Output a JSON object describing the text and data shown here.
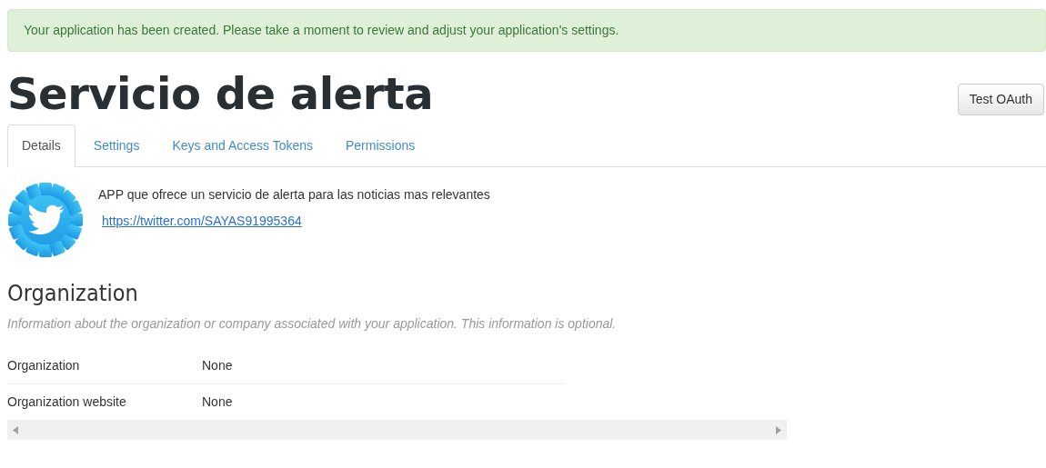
{
  "alert": {
    "text": "Your application has been created. Please take a moment to review and adjust your application's settings."
  },
  "title": "Servicio de alerta",
  "button": {
    "label": "Test OAuth"
  },
  "tabs": [
    {
      "label": "Details",
      "selected": true
    },
    {
      "label": "Settings",
      "selected": false
    },
    {
      "label": "Keys and Access Tokens",
      "selected": false
    },
    {
      "label": "Permissions",
      "selected": false
    }
  ],
  "app": {
    "description": "APP que ofrece un servicio de alerta para las noticias mas relevantes",
    "url": "https://twitter.com/SAYAS91995364"
  },
  "organization": {
    "heading": "Organization",
    "note": "Information about the organization or company associated with your application. This information is optional.",
    "rows": [
      {
        "label": "Organization",
        "value": "None"
      },
      {
        "label": "Organization website",
        "value": "None"
      }
    ]
  }
}
